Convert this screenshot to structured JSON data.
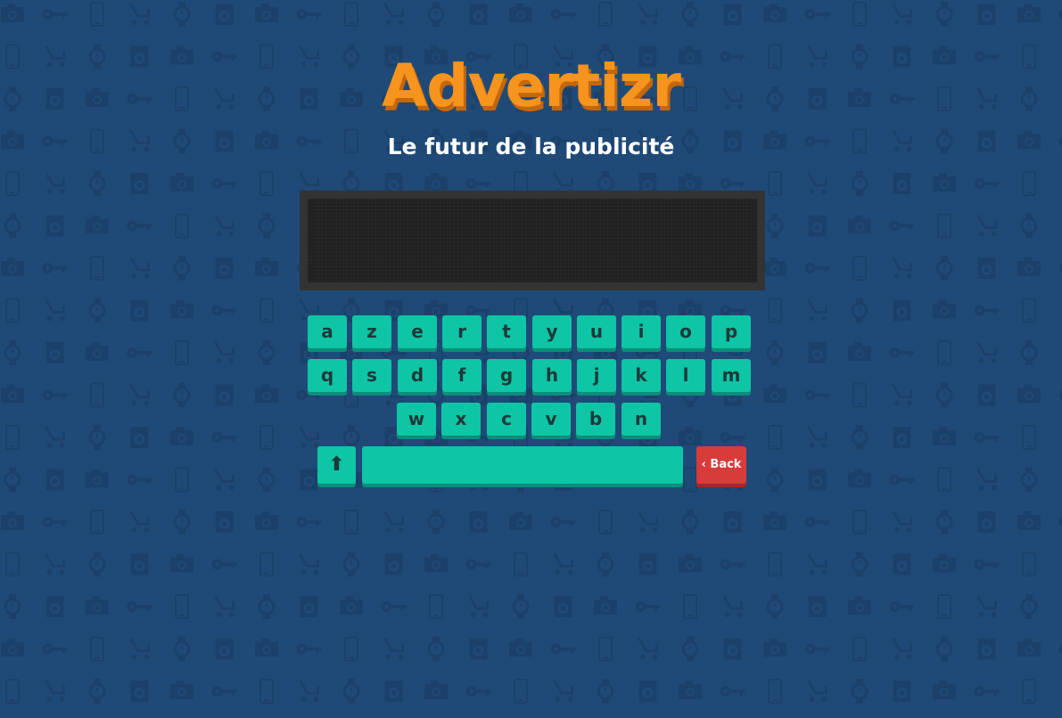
{
  "app": {
    "title": "Advertizr",
    "subtitle": "Le futur de la publicité"
  },
  "display": {
    "text": ""
  },
  "keyboard": {
    "rows": [
      [
        "a",
        "z",
        "e",
        "r",
        "t",
        "y",
        "u",
        "i",
        "o",
        "p"
      ],
      [
        "q",
        "s",
        "d",
        "f",
        "g",
        "h",
        "j",
        "k",
        "l",
        "m"
      ],
      [
        "w",
        "x",
        "c",
        "v",
        "b",
        "n"
      ]
    ],
    "shift_label": "⬆",
    "space_label": "",
    "back_label": "‹ Back"
  },
  "colors": {
    "background": "#1f4a78",
    "title": "#f7941d",
    "key": "#0ec5a5",
    "back_key": "#d93a3a",
    "screen": "#202020"
  },
  "background_icons": [
    "camera-icon",
    "key-icon",
    "phone-icon",
    "stroller-icon",
    "watch-icon",
    "washing-machine-icon"
  ]
}
